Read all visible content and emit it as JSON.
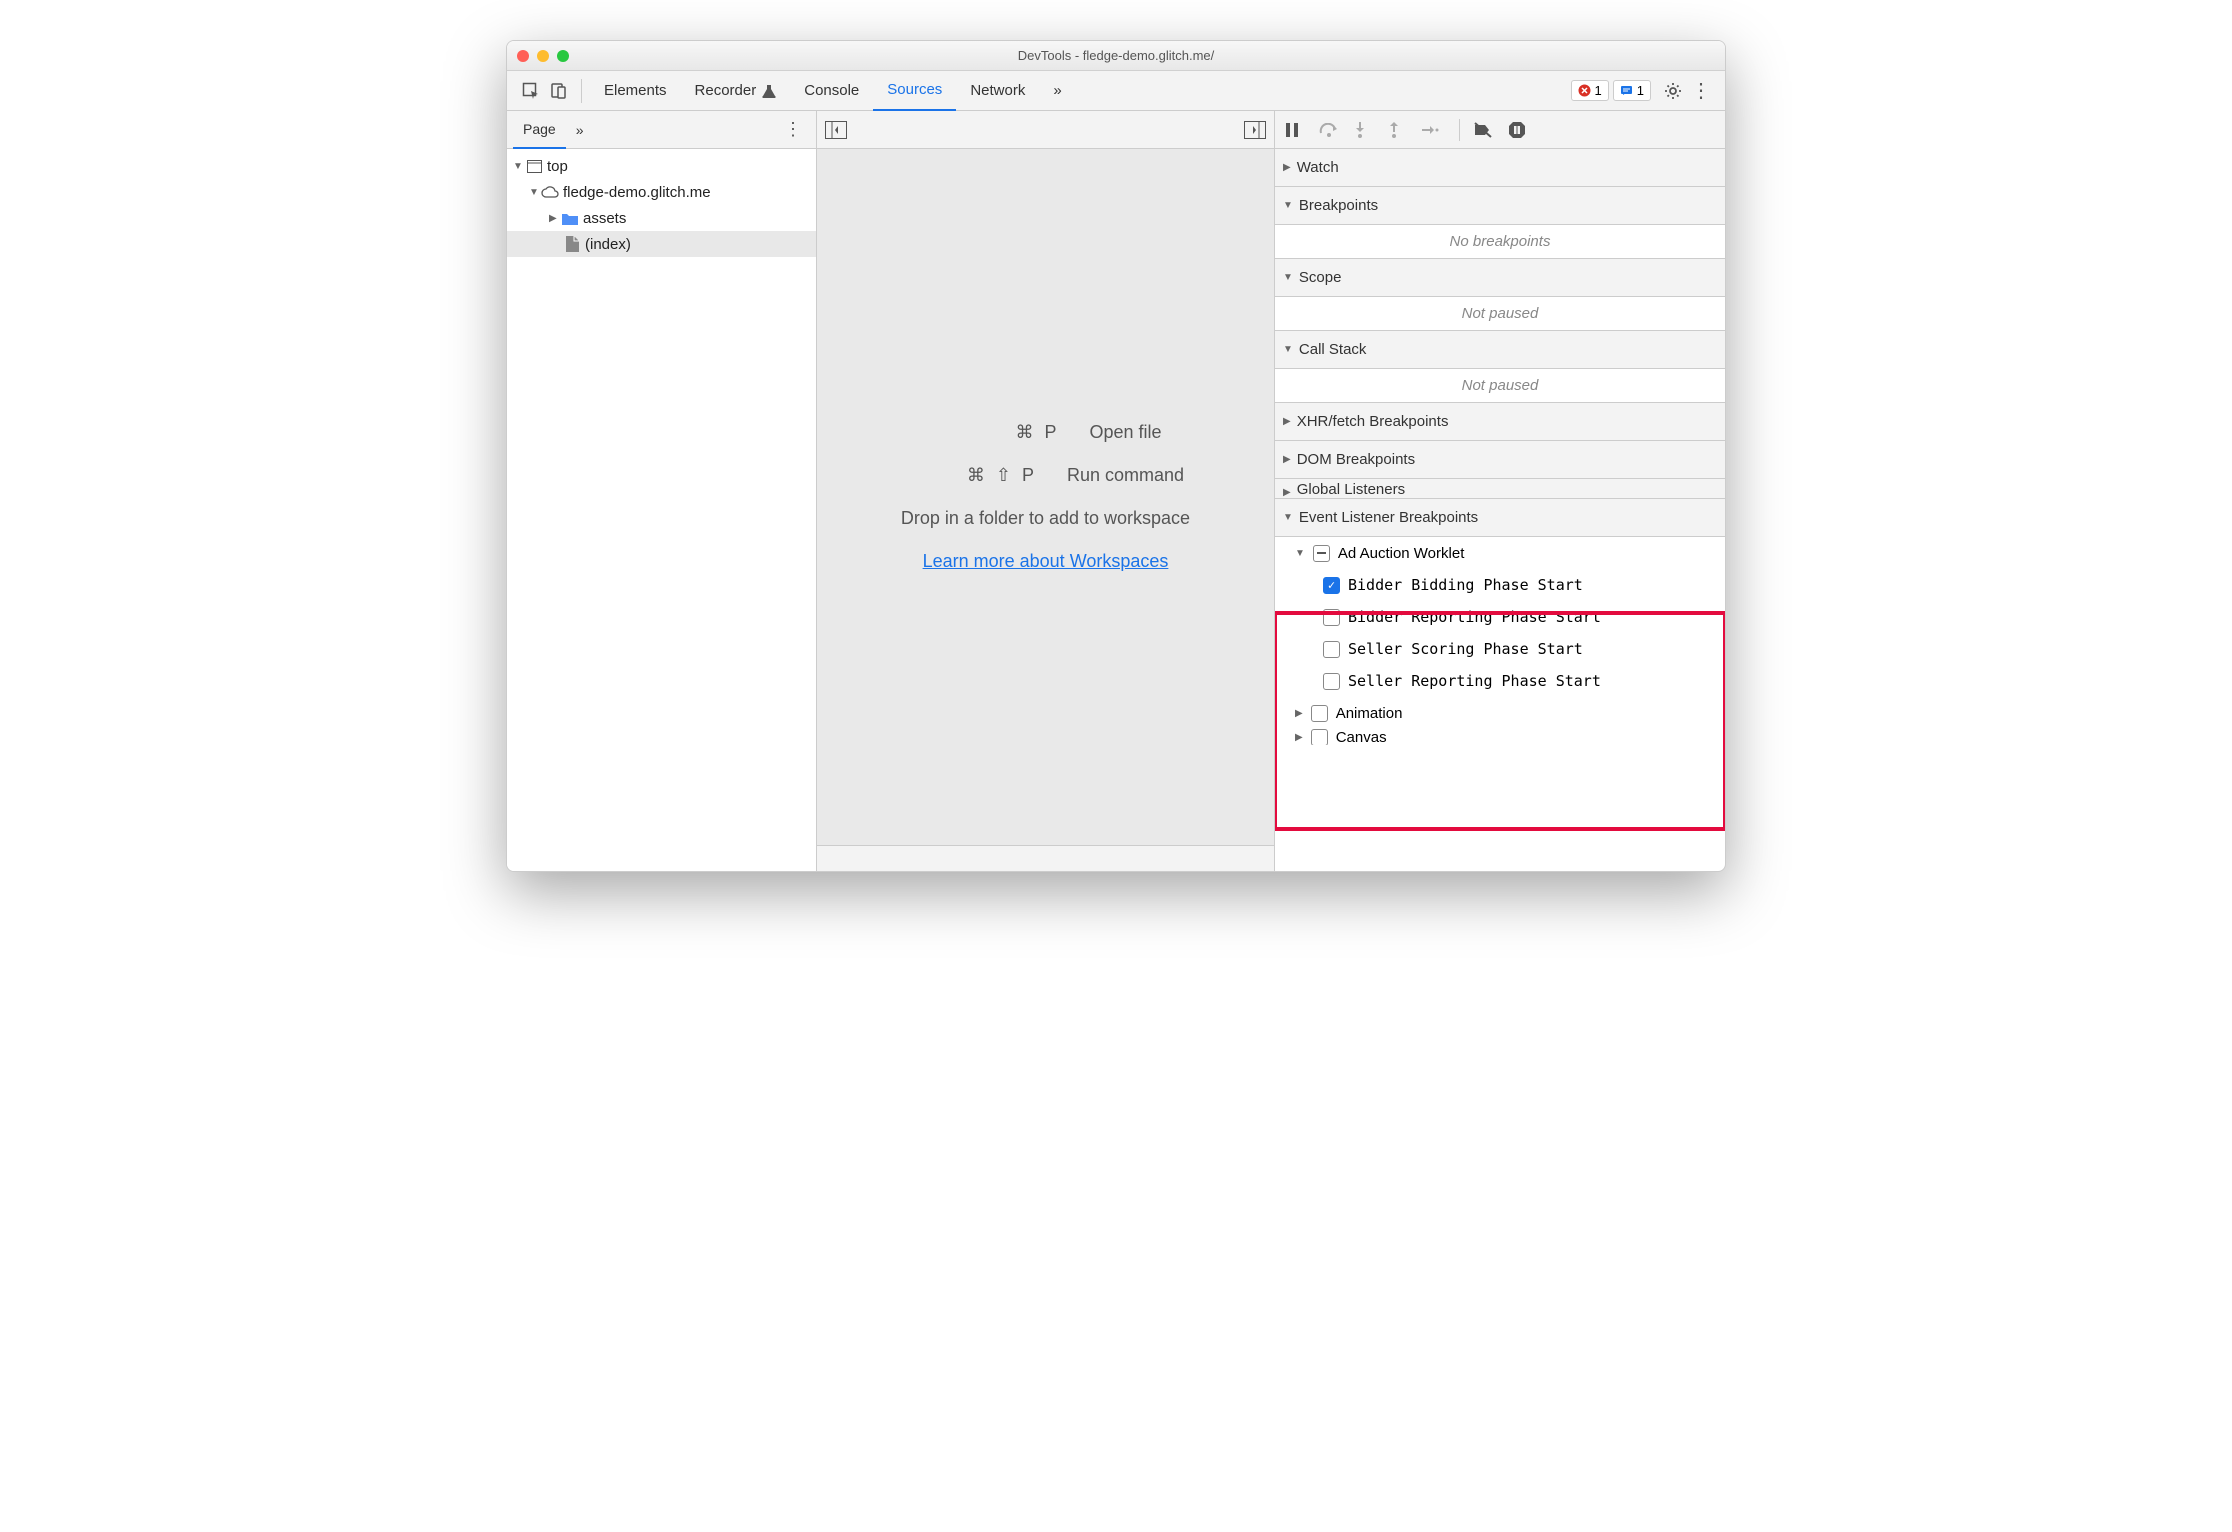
{
  "window": {
    "title": "DevTools - fledge-demo.glitch.me/"
  },
  "tabs": {
    "items": [
      "Elements",
      "Recorder",
      "Console",
      "Sources",
      "Network"
    ],
    "active": "Sources",
    "more": "»",
    "errors_count": "1",
    "messages_count": "1"
  },
  "left": {
    "tab_page": "Page",
    "more": "»",
    "tree": {
      "top": "top",
      "domain": "fledge-demo.glitch.me",
      "folder": "assets",
      "file": "(index)"
    }
  },
  "mid": {
    "open_keys": "⌘ P",
    "open_label": "Open file",
    "run_keys": "⌘ ⇧ P",
    "run_label": "Run command",
    "drop": "Drop in a folder to add to workspace",
    "learn": "Learn more about Workspaces"
  },
  "right": {
    "watch": "Watch",
    "breakpoints": "Breakpoints",
    "no_breakpoints": "No breakpoints",
    "scope": "Scope",
    "not_paused": "Not paused",
    "callstack": "Call Stack",
    "xhr": "XHR/fetch Breakpoints",
    "dom": "DOM Breakpoints",
    "global": "Global Listeners",
    "elb": "Event Listener Breakpoints",
    "adworklet": {
      "label": "Ad Auction Worklet",
      "items": [
        {
          "label": "Bidder Bidding Phase Start",
          "checked": true
        },
        {
          "label": "Bidder Reporting Phase Start",
          "checked": false
        },
        {
          "label": "Seller Scoring Phase Start",
          "checked": false
        },
        {
          "label": "Seller Reporting Phase Start",
          "checked": false
        }
      ]
    },
    "animation": "Animation",
    "canvas": "Canvas"
  }
}
